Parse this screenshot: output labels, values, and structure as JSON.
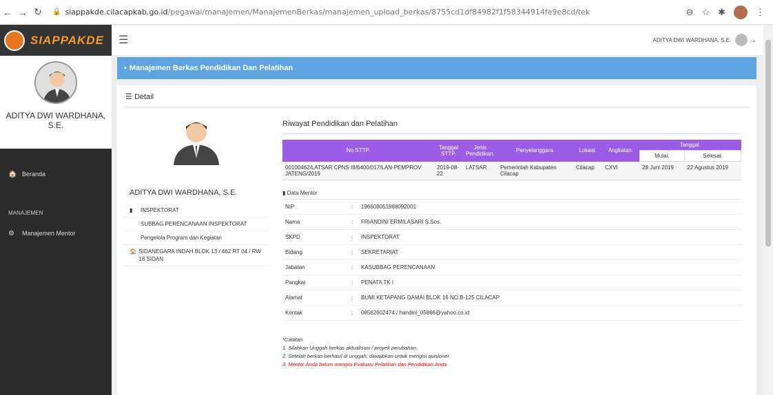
{
  "browser": {
    "url_host": "siappakde.cilacapkab.go.id",
    "url_path": "/pegawai/manajemen/ManajemenBerkas/manajemen_upload_berkas/8755cd1df84982f1f58344914fe9e8cd/tek"
  },
  "brand": {
    "name": "SIAPPAKDE"
  },
  "sidebar": {
    "user_name": "ADITYA DWI WARDHANA, S.E.",
    "beranda": "Beranda",
    "section_header": "MANAJEMEN",
    "manajemen_mentor": "Manajemen Mentor"
  },
  "topnav": {
    "user": "ADITYA DWI WARDHANA, S.E."
  },
  "header": {
    "title": "Manajemen Berkas Pendidikan Dan Pelatihan"
  },
  "panel": {
    "title": "Detail",
    "left_name": "ADITYA DWI WARDHANA, S.E.",
    "unit": "INSPEKTORAT",
    "subbag": "SUBBAG PERENCANAAN INSPEKTORAT",
    "jabatan": "Pengelola Program dan Kegiatan",
    "alamat": "SIDANEGARA INDAH BLOK 13 / 462 RT 04 / RW 18 SIDAN"
  },
  "riwayat": {
    "title": "Riwayat Pendidikan dan Pelatihan",
    "headers": {
      "no": "No STTP.",
      "tanggal": "Tanggal STTP.",
      "jenis": "Jenis Pendidikan.",
      "penyelenggara": "Penyelanggara.",
      "lokasi": "Lokasi.",
      "angkatan": "Angkatan.",
      "tanggal_group": "Tanggal.",
      "mulai": "Mulai.",
      "selesai": "Selesai."
    },
    "row": {
      "no": "00100462/LATSAR CPNS III/6400/017/LAN-PEMPROV JATENG/2019",
      "tanggal": "2019-08-22",
      "jenis": "LATSAR",
      "penyelenggara": "Pemerintah Kabupaten Cilacap",
      "lokasi": "Cilacap",
      "angkatan": "CXVI",
      "mulai": "28 Juni 2019",
      "selesai": "22 Agustus 2019"
    }
  },
  "mentor": {
    "title": "Data Mentor",
    "rows": [
      {
        "k": "NIP",
        "v": "196608051988092001"
      },
      {
        "k": "Nama",
        "v": "FRIANDINI ERMILASARI S.Sos."
      },
      {
        "k": "SKPD",
        "v": "INSPEKTORAT"
      },
      {
        "k": "Bidang",
        "v": "SEKRETARIAT"
      },
      {
        "k": "Jabatan",
        "v": "KASUBBAG PERENCANAAN"
      },
      {
        "k": "Pangkat",
        "v": "PENATA TK I"
      },
      {
        "k": "Alamat",
        "v": "BUMI KETAPANG DAMAI BLOK 16 NO.B-125 CILACAP"
      },
      {
        "k": "Kontak",
        "v": "08562602474 / handini_05866@yahoo.co.id"
      }
    ]
  },
  "notes": {
    "title": "*Catatan",
    "n1": "1. Silahkan Unggah berkas aktualisasi / proyek perubahan.",
    "n2": "2. Setelah berkas berhasil di unggah, diwajibkan untuk mengisi quisioner.",
    "n3": "3. Mentor Anda belum mengisi Evaluasi Pelatihan dan Pendidikan Anda."
  }
}
